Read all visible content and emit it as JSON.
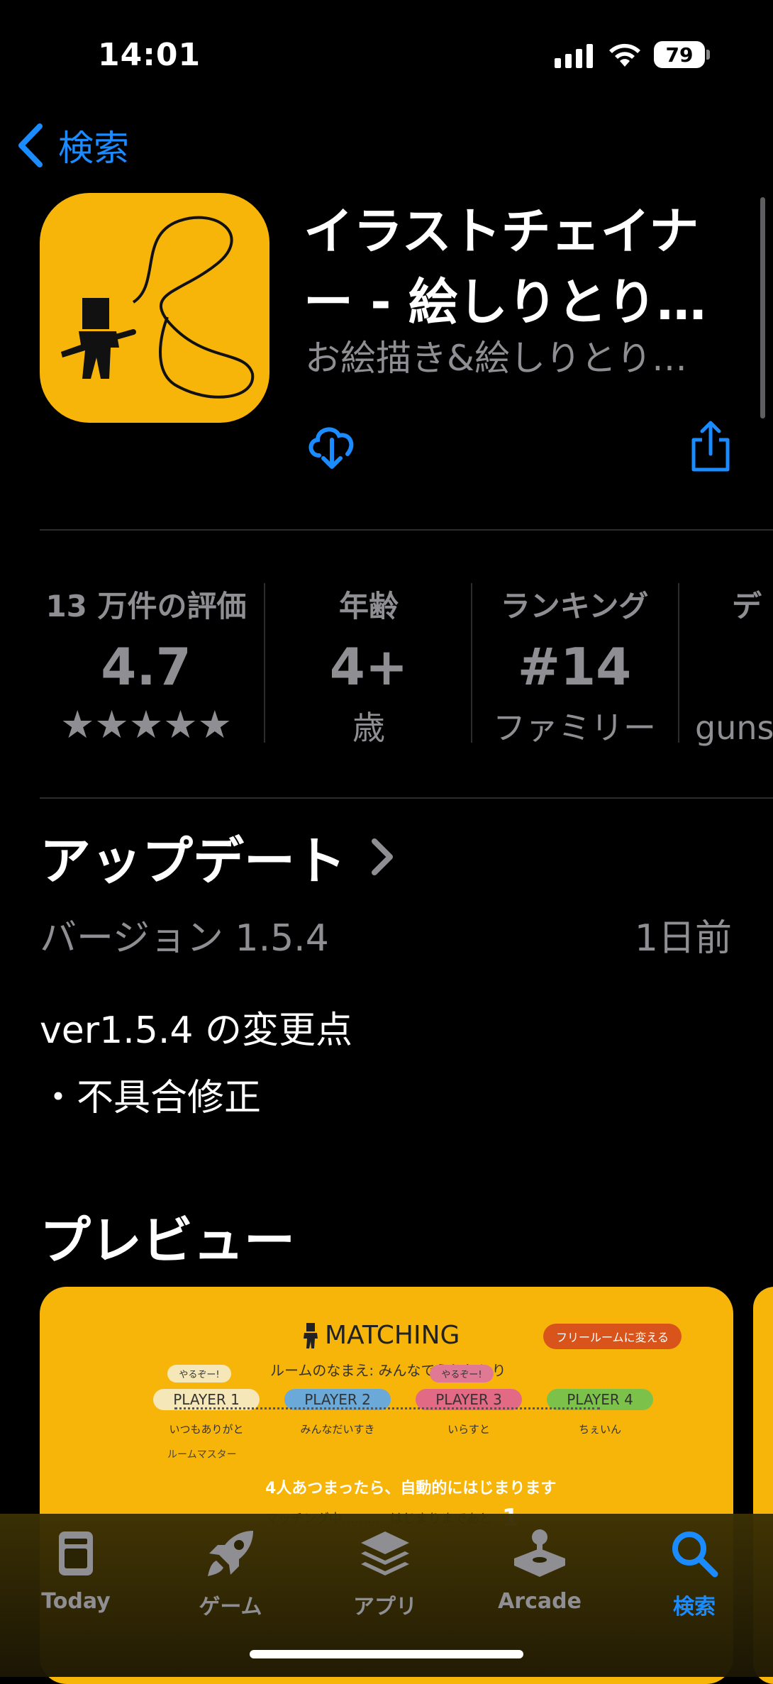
{
  "status_bar": {
    "time": "14:01",
    "battery": "79"
  },
  "nav": {
    "back_label": "検索"
  },
  "app": {
    "title_line1": "イラストチェイナ",
    "title_line2": "ー - 絵しりとり…",
    "subtitle": "お絵描き&絵しりとり…"
  },
  "info": {
    "ratings_label": "13 万件の評価",
    "rating_value": "4.7",
    "stars": "★★★★★",
    "age_label": "年齢",
    "age_value": "4+",
    "age_unit": "歳",
    "ranking_label": "ランキング",
    "ranking_value": "#14",
    "ranking_category": "ファミリー",
    "developer_label": "デ",
    "developer_value": "guns"
  },
  "update": {
    "heading": "アップデート",
    "version": "バージョン 1.5.4",
    "date": "1日前",
    "notes_title": "ver1.5.4 の変更点",
    "notes_item": "・不具合修正"
  },
  "preview": {
    "heading": "プレビュー",
    "screen_title": "MATCHING",
    "free_room": "フリールームに変える",
    "room_name": "ルームのなまえ: みんなでえしりとり",
    "players": [
      {
        "name": "PLAYER 1",
        "user": "いつもありがと",
        "tag": "やるぞー!",
        "color": "#f6e7b8"
      },
      {
        "name": "PLAYER 2",
        "user": "みんなだいすき",
        "tag": "",
        "color": "#6aa9d8"
      },
      {
        "name": "PLAYER 3",
        "user": "いらすと",
        "tag": "やるぞー!",
        "color": "#e36a84"
      },
      {
        "name": "PLAYER 4",
        "user": "ちぇいん",
        "tag": "",
        "color": "#7cc24a"
      }
    ],
    "room_master": "ルームマスター",
    "auto_start": "4人あつまったら、自動的にはじまります",
    "matching_status": "マッチング中………",
    "countdown_label": "はじまりまであと",
    "countdown_value": "1"
  },
  "tabs": [
    {
      "label": "Today",
      "icon": "today-icon"
    },
    {
      "label": "ゲーム",
      "icon": "rocket-icon"
    },
    {
      "label": "アプリ",
      "icon": "layers-icon"
    },
    {
      "label": "Arcade",
      "icon": "joystick-icon"
    },
    {
      "label": "検索",
      "icon": "search-icon",
      "active": true
    }
  ],
  "colors": {
    "accent": "#1a8cff",
    "app_yellow": "#f7b50a",
    "secondary_text": "#8e8e93"
  }
}
